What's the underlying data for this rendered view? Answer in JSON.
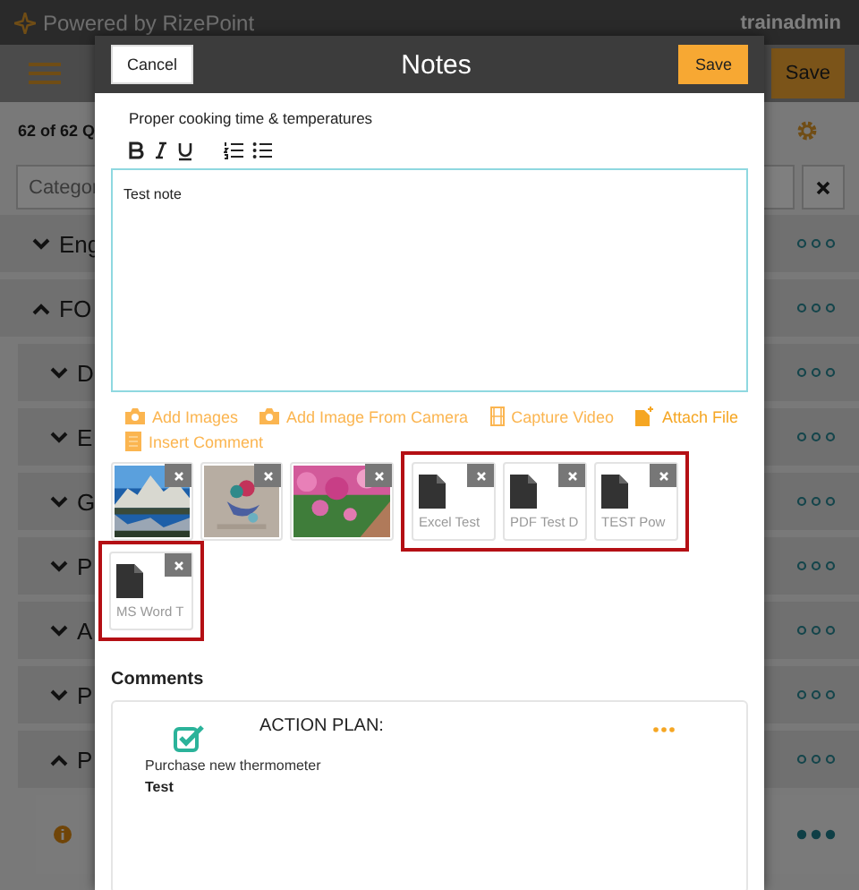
{
  "app_bar": {
    "brand": "Powered by RizePoint",
    "user": "trainadmin"
  },
  "nav_bar": {
    "save": "Save"
  },
  "count": "62 of 62 Q",
  "filter": {
    "placeholder": "Categor"
  },
  "categories": [
    {
      "label": "Eng",
      "kind": "category",
      "expanded": false
    },
    {
      "label": "FO",
      "kind": "category",
      "expanded": true,
      "children": [
        {
          "label": "D",
          "kind": "category",
          "expanded": false
        },
        {
          "label": "E",
          "kind": "category",
          "expanded": false
        },
        {
          "label": "G",
          "kind": "category",
          "expanded": false
        },
        {
          "label": "P",
          "kind": "category",
          "expanded": false
        },
        {
          "label": "A",
          "kind": "category",
          "expanded": false
        },
        {
          "label": "P",
          "kind": "category",
          "expanded": false
        },
        {
          "label": "P",
          "kind": "category",
          "expanded": true,
          "children": [
            {
              "kind": "question"
            }
          ]
        }
      ]
    }
  ],
  "modal": {
    "title": "Notes",
    "cancel": "Cancel",
    "save": "Save",
    "question": "Proper cooking time & temperatures",
    "note": "Test note",
    "actions": [
      {
        "label": "Add Images",
        "kind": "camera"
      },
      {
        "label": "Add Image From Camera",
        "kind": "camera"
      },
      {
        "label": "Capture Video",
        "kind": "video"
      },
      {
        "label": "Attach File",
        "kind": "file"
      },
      {
        "label": "Insert Comment",
        "kind": "comment"
      }
    ],
    "attachment_rows": [
      {
        "groups": [
          {
            "highlighted": false
          },
          {
            "highlighted": true,
            "items": [
              {
                "kind": "file",
                "name": "Excel Test"
              },
              {
                "kind": "file",
                "name": "PDF Test D"
              },
              {
                "kind": "file",
                "name": "TEST Pow"
              }
            ]
          }
        ]
      },
      {
        "groups": [
          {
            "highlighted": true,
            "items": [
              {
                "kind": "file",
                "name": "MS Word T"
              }
            ]
          }
        ]
      }
    ],
    "comments_title": "Comments",
    "comments": [
      {
        "title": "ACTION PLAN:",
        "done": true,
        "text": "Purchase new thermometer",
        "author": "Test"
      }
    ]
  }
}
